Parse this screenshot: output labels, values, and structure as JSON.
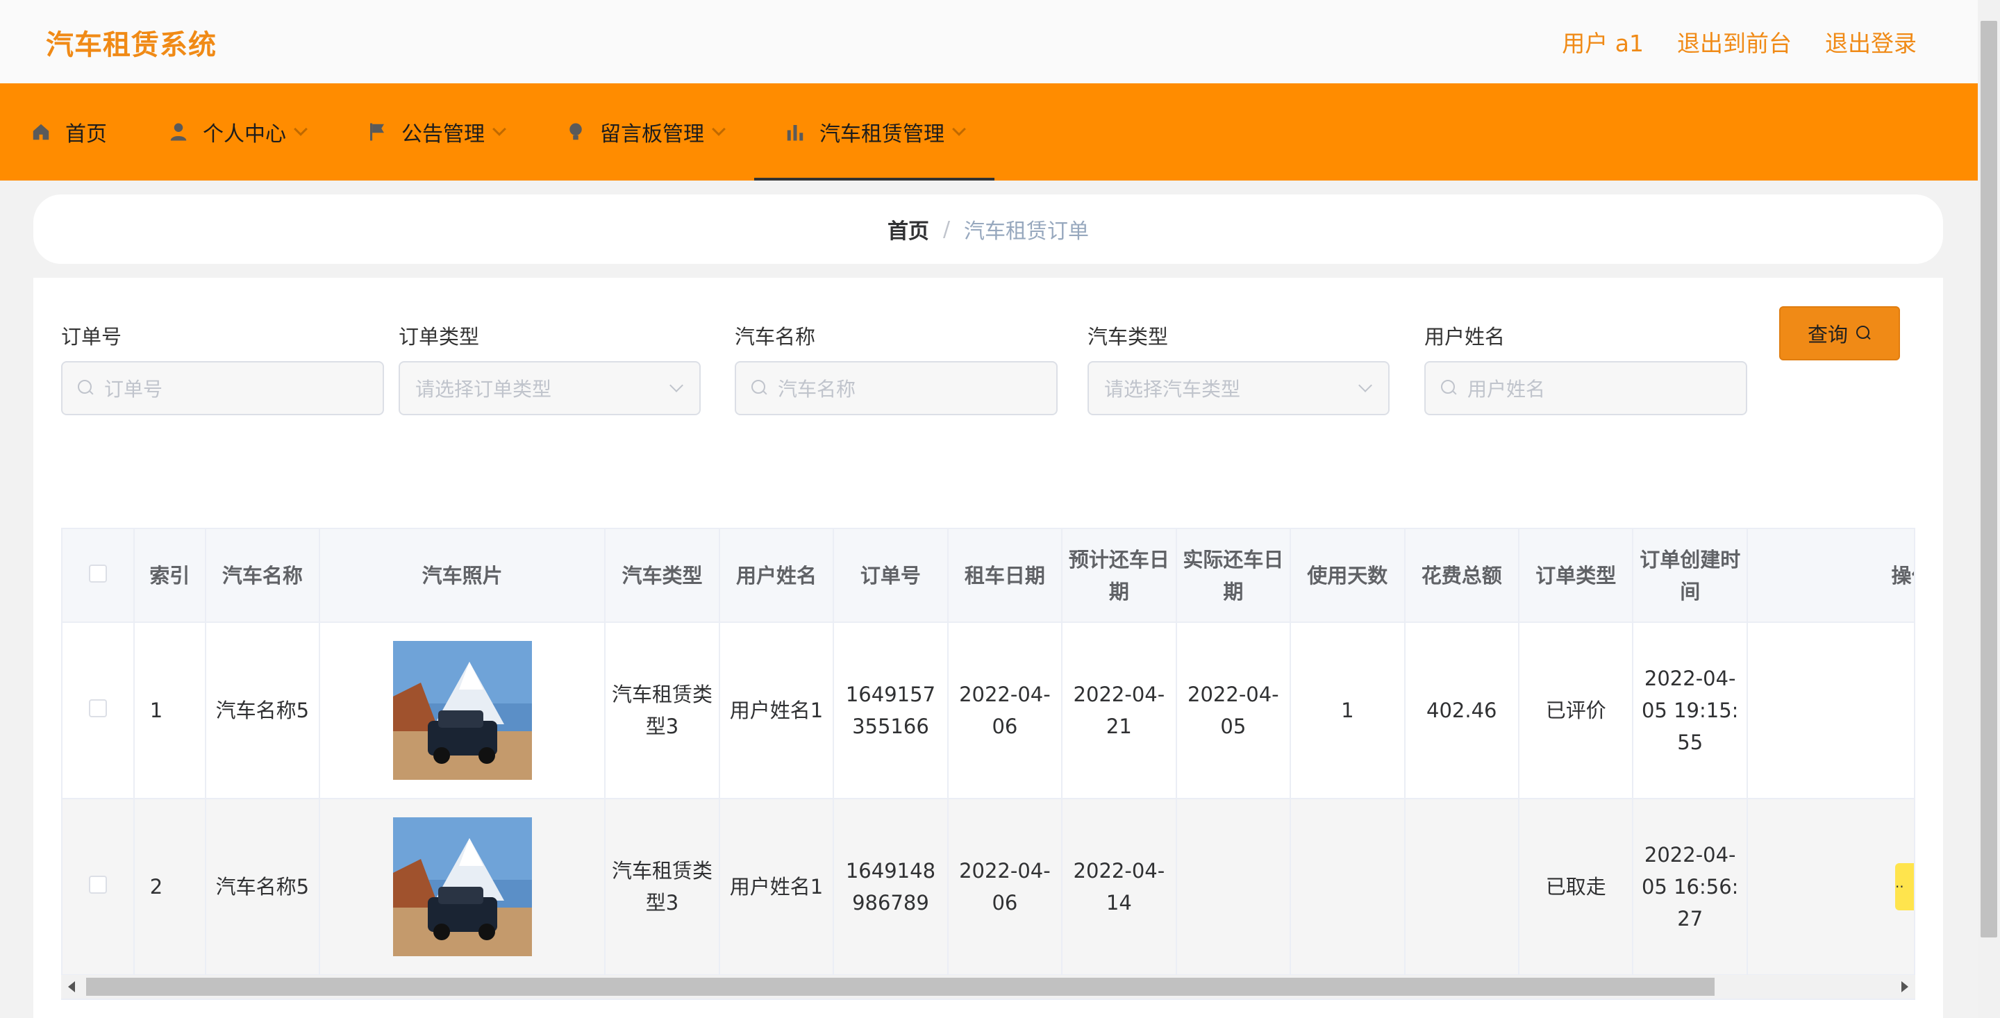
{
  "header": {
    "brand": "汽车租赁系统",
    "user_label": "用户 a1",
    "back_to_front": "退出到前台",
    "logout": "退出登录"
  },
  "nav": {
    "items": [
      {
        "label": "首页",
        "icon": "home-icon"
      },
      {
        "label": "个人中心",
        "icon": "user-icon"
      },
      {
        "label": "公告管理",
        "icon": "flag-icon"
      },
      {
        "label": "留言板管理",
        "icon": "bulb-icon"
      },
      {
        "label": "汽车租赁管理",
        "icon": "chart-icon"
      }
    ],
    "active": "汽车租赁管理"
  },
  "breadcrumb": {
    "home": "首页",
    "separator": "/",
    "current": "汽车租赁订单"
  },
  "filters": {
    "order_no": {
      "label": "订单号",
      "placeholder": "订单号"
    },
    "order_type": {
      "label": "订单类型",
      "placeholder": "请选择订单类型"
    },
    "car_name": {
      "label": "汽车名称",
      "placeholder": "汽车名称"
    },
    "car_type": {
      "label": "汽车类型",
      "placeholder": "请选择汽车类型"
    },
    "user_name": {
      "label": "用户姓名",
      "placeholder": "用户姓名"
    },
    "query_button": "查询"
  },
  "table": {
    "headers": [
      "索引",
      "汽车名称",
      "汽车照片",
      "汽车类型",
      "用户姓名",
      "订单号",
      "租车日期",
      "预计还车日期",
      "实际还车日期",
      "使用天数",
      "花费总额",
      "订单类型",
      "订单创建时间",
      "操作"
    ],
    "rows": [
      {
        "index": "1",
        "car_name": "汽车名称5",
        "car_type": "汽车租赁类型3",
        "user_name": "用户姓名1",
        "order_no": "1649157355166",
        "rent_date": "2022-04-06",
        "expected_return": "2022-04-21",
        "actual_return": "2022-04-05",
        "days": "1",
        "total": "402.46",
        "order_type": "已评价",
        "created": "2022-04-05 19:15:55",
        "op": "··"
      },
      {
        "index": "2",
        "car_name": "汽车名称5",
        "car_type": "汽车租赁类型3",
        "user_name": "用户姓名1",
        "order_no": "1649148986789",
        "rent_date": "2022-04-06",
        "expected_return": "2022-04-14",
        "actual_return": "",
        "days": "",
        "total": "",
        "order_type": "已取走",
        "created": "2022-04-05 16:56:27",
        "op": "··"
      }
    ]
  },
  "colors": {
    "accent": "#ff8c00",
    "brand_text": "#f08a16",
    "op_button": "#ffe44d"
  }
}
